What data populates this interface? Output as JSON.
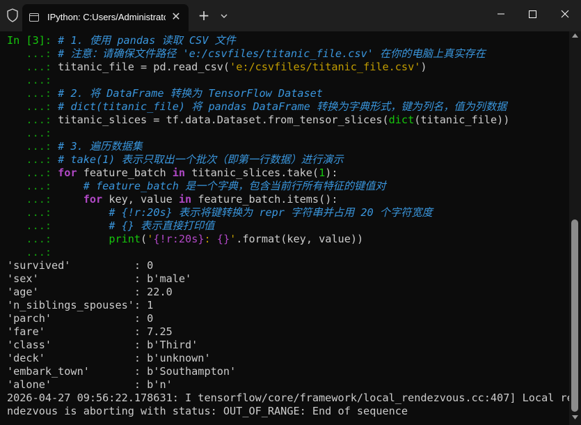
{
  "tab": {
    "title": "IPython: C:Users/Administrato",
    "close": "✕"
  },
  "newtab": "+",
  "icons": {
    "shield": "shield-icon",
    "terminal": "terminal-icon",
    "close": "close-icon",
    "chevron": "chevron-down-icon"
  },
  "colors": {
    "background": "#0c0c0c",
    "titlebar": "#1f1f1f",
    "prompt": "#16c60c",
    "comment": "#3a96dd",
    "keyword": "#b148c6",
    "string": "#c19c00",
    "text": "#cccccc"
  },
  "prompts": {
    "input": "In [3]: ",
    "cont": "   ...: "
  },
  "code_lines": [
    [
      [
        "cm",
        "# 1. 使用 pandas 读取 CSV 文件"
      ]
    ],
    [
      [
        "cm",
        "# 注意：请确保文件路径 'e:/csvfiles/titanic_file.csv' 在你的电脑上真实存在"
      ]
    ],
    [
      [
        "",
        "titanic_file = pd.read_csv("
      ],
      [
        "st",
        "'e:/csvfiles/titanic_file.csv'"
      ],
      [
        "",
        ")"
      ]
    ],
    [],
    [
      [
        "cm",
        "# 2. 将 DataFrame 转换为 TensorFlow Dataset"
      ]
    ],
    [
      [
        "cm",
        "# dict(titanic_file) 将 pandas DataFrame 转换为字典形式，键为列名，值为列数据"
      ]
    ],
    [
      [
        "",
        "titanic_slices = tf.data.Dataset.from_tensor_slices("
      ],
      [
        "bi",
        "dict"
      ],
      [
        "",
        "(titanic_file))"
      ]
    ],
    [],
    [
      [
        "cm",
        "# 3. 遍历数据集"
      ]
    ],
    [
      [
        "cm",
        "# take(1) 表示只取出一个批次（即第一行数据）进行演示"
      ]
    ],
    [
      [
        "kw",
        "for"
      ],
      [
        "",
        " feature_batch "
      ],
      [
        "kw",
        "in"
      ],
      [
        "",
        " titanic_slices.take("
      ],
      [
        "bi",
        "1"
      ],
      [
        "",
        "):"
      ]
    ],
    [
      [
        "",
        "    "
      ],
      [
        "cm",
        "# feature_batch 是一个字典，包含当前行所有特征的键值对"
      ]
    ],
    [
      [
        "",
        "    "
      ],
      [
        "kw",
        "for"
      ],
      [
        "",
        " key, value "
      ],
      [
        "kw",
        "in"
      ],
      [
        "",
        " feature_batch.items():"
      ]
    ],
    [
      [
        "",
        "        "
      ],
      [
        "cm",
        "# {!r:20s} 表示将键转换为 repr 字符串并占用 20 个字符宽度"
      ]
    ],
    [
      [
        "",
        "        "
      ],
      [
        "cm",
        "# {} 表示直接打印值"
      ]
    ],
    [
      [
        "",
        "        "
      ],
      [
        "bi",
        "print"
      ],
      [
        "",
        "("
      ],
      [
        "st",
        "'"
      ],
      [
        "sp",
        "{!r:20s}"
      ],
      [
        "st",
        ": "
      ],
      [
        "sp",
        "{}"
      ],
      [
        "st",
        "'"
      ],
      [
        "",
        ".format(key, value))"
      ]
    ],
    []
  ],
  "output_lines": [
    "'survived'          : 0",
    "'sex'               : b'male'",
    "'age'               : 22.0",
    "'n_siblings_spouses': 1",
    "'parch'             : 0",
    "'fare'              : 7.25",
    "'class'             : b'Third'",
    "'deck'              : b'unknown'",
    "'embark_town'       : b'Southampton'",
    "'alone'             : b'n'",
    "2026-04-27 09:56:22.178631: I tensorflow/core/framework/local_rendezvous.cc:407] Local re",
    "ndezvous is aborting with status: OUT_OF_RANGE: End of sequence"
  ]
}
